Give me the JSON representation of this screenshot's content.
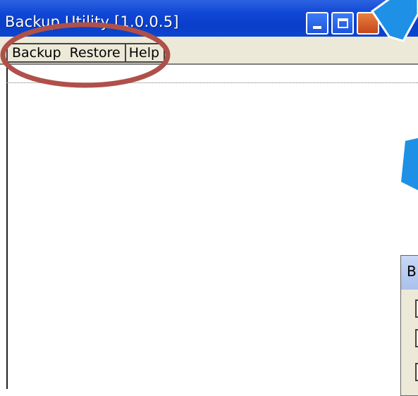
{
  "window": {
    "title": "Backup Utility [1.0.0.5]",
    "buttons": {
      "minimize": "minimize",
      "maximize": "maximize",
      "close": "close"
    }
  },
  "menubar": {
    "items": [
      {
        "label": "Backup"
      },
      {
        "label": "Restore"
      },
      {
        "label": "Help"
      }
    ]
  },
  "dialog": {
    "title_visible": "B"
  },
  "colors": {
    "titlebar_blue": "#0a3ec8",
    "menubar_bg": "#ece9d8",
    "annotation_ring": "#b0504a",
    "annotation_arrow": "#1e90e6"
  },
  "icons": [
    "minimize-icon",
    "maximize-icon",
    "close-icon"
  ]
}
